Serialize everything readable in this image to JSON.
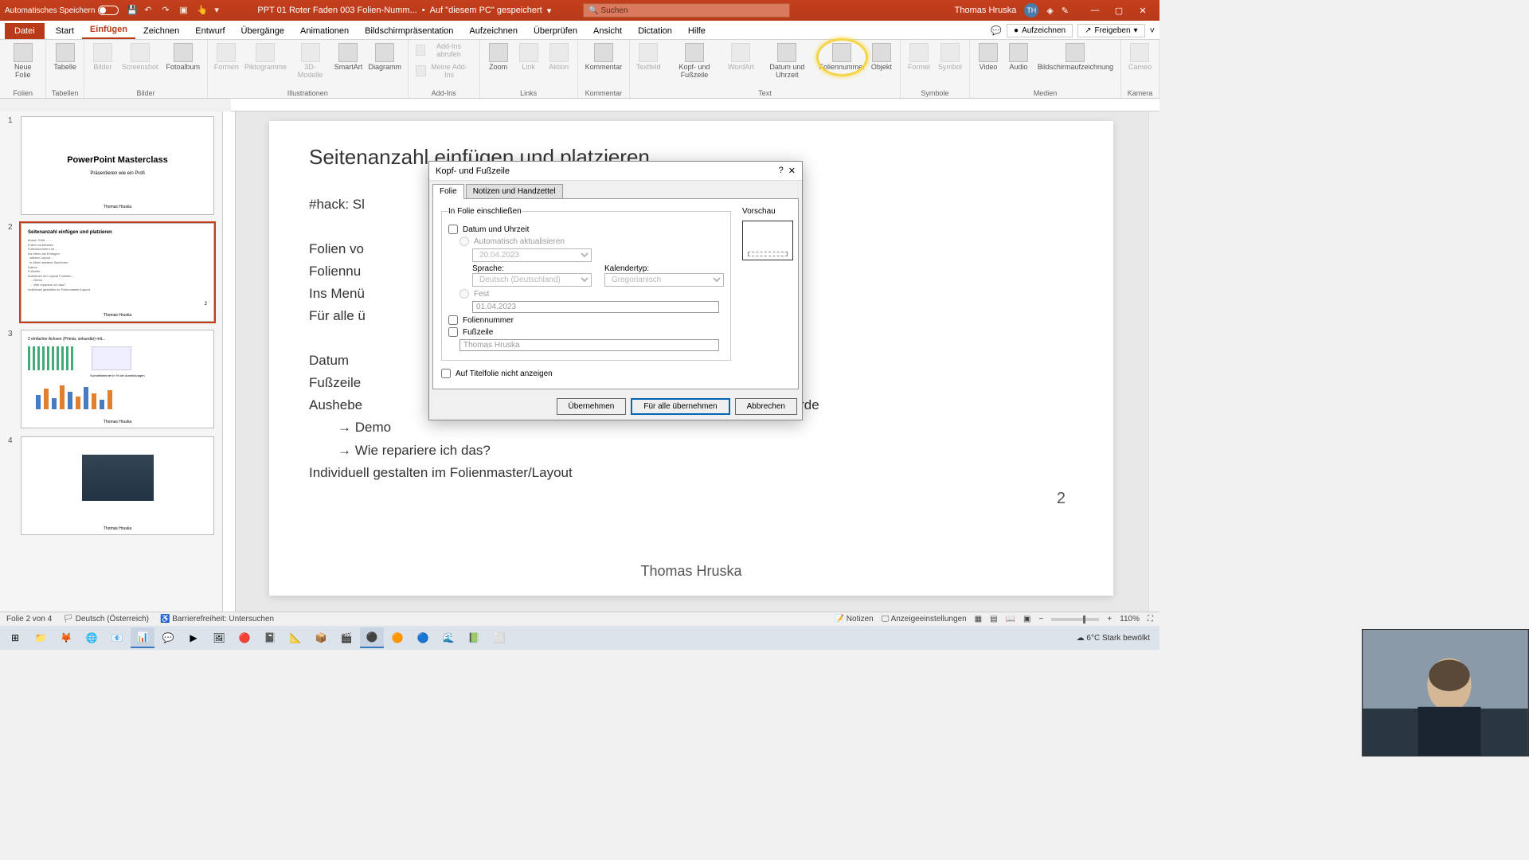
{
  "titlebar": {
    "autosave": "Automatisches Speichern",
    "filename": "PPT 01 Roter Faden 003 Folien-Numm...",
    "saved": "Auf \"diesem PC\" gespeichert",
    "search_placeholder": "Suchen",
    "user": "Thomas Hruska",
    "user_initials": "TH"
  },
  "tabs": {
    "file": "Datei",
    "items": [
      "Start",
      "Einfügen",
      "Zeichnen",
      "Entwurf",
      "Übergänge",
      "Animationen",
      "Bildschirmpräsentation",
      "Aufzeichnen",
      "Überprüfen",
      "Ansicht",
      "Dictation",
      "Hilfe"
    ],
    "active_index": 1,
    "record": "Aufzeichnen",
    "share": "Freigeben"
  },
  "ribbon": {
    "groups": {
      "folien": {
        "label": "Folien",
        "items": [
          "Neue Folie"
        ]
      },
      "tabellen": {
        "label": "Tabellen",
        "items": [
          "Tabelle"
        ]
      },
      "bilder": {
        "label": "Bilder",
        "items": [
          "Bilder",
          "Screenshot",
          "Fotoalbum"
        ]
      },
      "illustrationen": {
        "label": "Illustrationen",
        "items": [
          "Formen",
          "Piktogramme",
          "3D-Modelle",
          "SmartArt",
          "Diagramm"
        ]
      },
      "addins": {
        "label": "Add-Ins",
        "items": [
          "Add-Ins abrufen",
          "Meine Add-Ins"
        ]
      },
      "links": {
        "label": "Links",
        "items": [
          "Zoom",
          "Link",
          "Aktion"
        ]
      },
      "kommentar": {
        "label": "Kommentar",
        "items": [
          "Kommentar"
        ]
      },
      "text": {
        "label": "Text",
        "items": [
          "Textfeld",
          "Kopf- und Fußzeile",
          "WordArt",
          "Datum und Uhrzeit",
          "Foliennummer",
          "Objekt"
        ]
      },
      "symbole": {
        "label": "Symbole",
        "items": [
          "Formel",
          "Symbol"
        ]
      },
      "medien": {
        "label": "Medien",
        "items": [
          "Video",
          "Audio",
          "Bildschirmaufzeichnung"
        ]
      },
      "kamera": {
        "label": "Kamera",
        "items": [
          "Cameo"
        ]
      }
    }
  },
  "thumbs": {
    "slide1": {
      "title": "PowerPoint Masterclass",
      "subtitle": "Präsentieren wie ein Profi",
      "author": "Thomas Hruska"
    },
    "slide3_author": "Thomas Hruska",
    "slide4_author": "Thomas Hruska"
  },
  "slide": {
    "title": "Seitenanzahl einfügen und platzieren",
    "lines": {
      "l1": "#hack: Sl",
      "l2": "Folien vo",
      "l3": "Foliennu",
      "l4": "Ins Menü",
      "l5": "Für alle ü",
      "l6": "Datum",
      "l7": "Fußzeile",
      "l8_a": "Aushebe",
      "l8_b": "indert wurde",
      "l9": "Demo",
      "l10": "Wie repariere ich das?",
      "l11": "Individuell gestalten im Folienmaster/Layout"
    },
    "page_number": "2",
    "footer_author": "Thomas Hruska"
  },
  "dialog": {
    "title": "Kopf- und Fußzeile",
    "tab1": "Folie",
    "tab2": "Notizen und Handzettel",
    "group_label": "In Folie einschließen",
    "datetime": "Datum und Uhrzeit",
    "auto_update": "Automatisch aktualisieren",
    "date_value": "20.04.2023",
    "lang_label": "Sprache:",
    "lang_value": "Deutsch (Deutschland)",
    "cal_label": "Kalendertyp:",
    "cal_value": "Gregorianisch",
    "fixed": "Fest",
    "fixed_value": "01.04.2023",
    "slide_number": "Foliennummer",
    "footer": "Fußzeile",
    "footer_value": "Thomas Hruska",
    "hide_title": "Auf Titelfolie nicht anzeigen",
    "preview": "Vorschau",
    "btn_apply": "Übernehmen",
    "btn_apply_all": "Für alle übernehmen",
    "btn_cancel": "Abbrechen"
  },
  "statusbar": {
    "slide_info": "Folie 2 von 4",
    "lang": "Deutsch (Österreich)",
    "access": "Barrierefreiheit: Untersuchen",
    "notes": "Notizen",
    "display": "Anzeigeeinstellungen",
    "zoom": "110%"
  },
  "taskbar": {
    "weather": "6°C  Stark bewölkt"
  }
}
